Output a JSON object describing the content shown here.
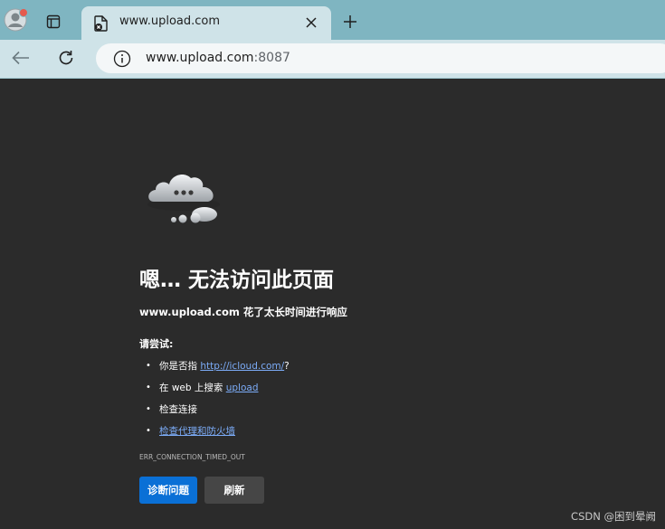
{
  "browser": {
    "tab_title": "www.upload.com",
    "url_host": "www.upload.com",
    "url_port": ":8087"
  },
  "error_page": {
    "headline": "嗯… 无法访问此页面",
    "subtitle": "www.upload.com 花了太长时间进行响应",
    "try_label": "请尝试:",
    "suggestions": [
      {
        "prefix": "你是否指 ",
        "link": "http://icloud.com/",
        "suffix": "?"
      },
      {
        "prefix": "在 web 上搜索 ",
        "link": "upload",
        "suffix": ""
      },
      {
        "prefix": "检查连接",
        "link": "",
        "suffix": ""
      },
      {
        "prefix": "",
        "link": "检查代理和防火墙",
        "suffix": ""
      }
    ],
    "error_code": "ERR_CONNECTION_TIMED_OUT",
    "buttons": {
      "diagnose": "诊断问题",
      "reload": "刷新"
    }
  },
  "watermark": "CSDN @困到晕阙",
  "colors": {
    "accent": "#0a70d6",
    "link": "#7cacf8",
    "background": "#2b2b2b",
    "chrome": "#7fb5c1"
  }
}
